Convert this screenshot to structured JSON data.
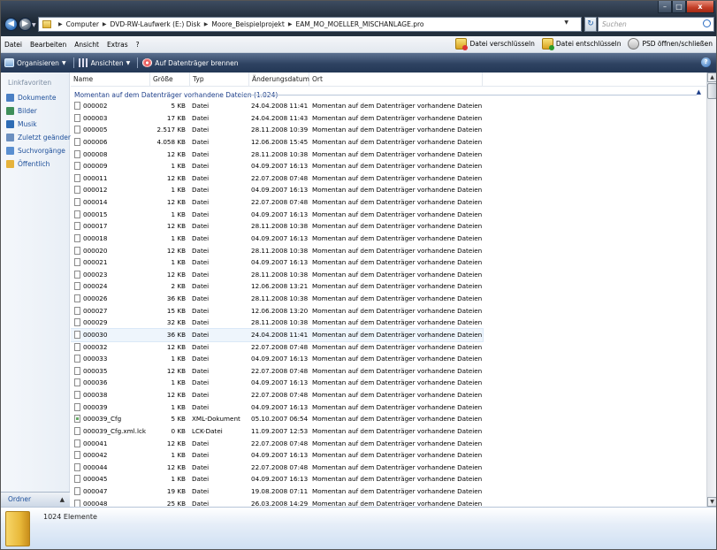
{
  "window": {
    "minimize_label": "–",
    "maximize_label": "□",
    "close_label": "x"
  },
  "address": {
    "crumbs": [
      "Computer",
      "DVD-RW-Laufwerk (E:) Disk",
      "Moore_Beispielprojekt",
      "EAM_MO_MOELLER_MISCHANLAGE.pro"
    ],
    "search_placeholder": "Suchen"
  },
  "menu": {
    "items": [
      "Datei",
      "Bearbeiten",
      "Ansicht",
      "Extras",
      "?"
    ],
    "right": [
      "Datei verschlüsseln",
      "Datei entschlüsseln",
      "PSD öffnen/schließen"
    ]
  },
  "toolbar": {
    "organize": "Organisieren",
    "views": "Ansichten",
    "burn": "Auf Datenträger brennen"
  },
  "navpane": {
    "heading": "Linkfavoriten",
    "links": [
      "Dokumente",
      "Bilder",
      "Musik",
      "Zuletzt geändert",
      "Suchvorgänge",
      "Öffentlich"
    ],
    "icon_colors": [
      "#4a7fc4",
      "#3f8f5a",
      "#2e6cb5",
      "#6b8fc0",
      "#5a8fd0",
      "#e6b33c"
    ],
    "folders_label": "Ordner"
  },
  "columns": {
    "name": "Name",
    "size": "Größe",
    "type": "Typ",
    "date": "Änderungsdatum",
    "location": "Ort"
  },
  "group_header": "Momentan auf dem Datenträger vorhandene Dateien (1.024)",
  "files": [
    {
      "name": "000002",
      "size": "5 KB",
      "type": "Datei",
      "date": "24.04.2008 11:41",
      "ort": "Momentan auf dem Datenträger vorhandene Dateien"
    },
    {
      "name": "000003",
      "size": "17 KB",
      "type": "Datei",
      "date": "24.04.2008 11:43",
      "ort": "Momentan auf dem Datenträger vorhandene Dateien"
    },
    {
      "name": "000005",
      "size": "2.517 KB",
      "type": "Datei",
      "date": "28.11.2008 10:39",
      "ort": "Momentan auf dem Datenträger vorhandene Dateien"
    },
    {
      "name": "000006",
      "size": "4.058 KB",
      "type": "Datei",
      "date": "12.06.2008 15:45",
      "ort": "Momentan auf dem Datenträger vorhandene Dateien"
    },
    {
      "name": "000008",
      "size": "12 KB",
      "type": "Datei",
      "date": "28.11.2008 10:38",
      "ort": "Momentan auf dem Datenträger vorhandene Dateien"
    },
    {
      "name": "000009",
      "size": "1 KB",
      "type": "Datei",
      "date": "04.09.2007 16:13",
      "ort": "Momentan auf dem Datenträger vorhandene Dateien"
    },
    {
      "name": "000011",
      "size": "12 KB",
      "type": "Datei",
      "date": "22.07.2008 07:48",
      "ort": "Momentan auf dem Datenträger vorhandene Dateien"
    },
    {
      "name": "000012",
      "size": "1 KB",
      "type": "Datei",
      "date": "04.09.2007 16:13",
      "ort": "Momentan auf dem Datenträger vorhandene Dateien"
    },
    {
      "name": "000014",
      "size": "12 KB",
      "type": "Datei",
      "date": "22.07.2008 07:48",
      "ort": "Momentan auf dem Datenträger vorhandene Dateien"
    },
    {
      "name": "000015",
      "size": "1 KB",
      "type": "Datei",
      "date": "04.09.2007 16:13",
      "ort": "Momentan auf dem Datenträger vorhandene Dateien"
    },
    {
      "name": "000017",
      "size": "12 KB",
      "type": "Datei",
      "date": "28.11.2008 10:38",
      "ort": "Momentan auf dem Datenträger vorhandene Dateien"
    },
    {
      "name": "000018",
      "size": "1 KB",
      "type": "Datei",
      "date": "04.09.2007 16:13",
      "ort": "Momentan auf dem Datenträger vorhandene Dateien"
    },
    {
      "name": "000020",
      "size": "12 KB",
      "type": "Datei",
      "date": "28.11.2008 10:38",
      "ort": "Momentan auf dem Datenträger vorhandene Dateien"
    },
    {
      "name": "000021",
      "size": "1 KB",
      "type": "Datei",
      "date": "04.09.2007 16:13",
      "ort": "Momentan auf dem Datenträger vorhandene Dateien"
    },
    {
      "name": "000023",
      "size": "12 KB",
      "type": "Datei",
      "date": "28.11.2008 10:38",
      "ort": "Momentan auf dem Datenträger vorhandene Dateien"
    },
    {
      "name": "000024",
      "size": "2 KB",
      "type": "Datei",
      "date": "12.06.2008 13:21",
      "ort": "Momentan auf dem Datenträger vorhandene Dateien"
    },
    {
      "name": "000026",
      "size": "36 KB",
      "type": "Datei",
      "date": "28.11.2008 10:38",
      "ort": "Momentan auf dem Datenträger vorhandene Dateien"
    },
    {
      "name": "000027",
      "size": "15 KB",
      "type": "Datei",
      "date": "12.06.2008 13:20",
      "ort": "Momentan auf dem Datenträger vorhandene Dateien"
    },
    {
      "name": "000029",
      "size": "32 KB",
      "type": "Datei",
      "date": "28.11.2008 10:38",
      "ort": "Momentan auf dem Datenträger vorhandene Dateien"
    },
    {
      "name": "000030",
      "size": "36 KB",
      "type": "Datei",
      "date": "24.04.2008 11:41",
      "ort": "Momentan auf dem Datenträger vorhandene Dateien",
      "selected": true
    },
    {
      "name": "000032",
      "size": "12 KB",
      "type": "Datei",
      "date": "22.07.2008 07:48",
      "ort": "Momentan auf dem Datenträger vorhandene Dateien"
    },
    {
      "name": "000033",
      "size": "1 KB",
      "type": "Datei",
      "date": "04.09.2007 16:13",
      "ort": "Momentan auf dem Datenträger vorhandene Dateien"
    },
    {
      "name": "000035",
      "size": "12 KB",
      "type": "Datei",
      "date": "22.07.2008 07:48",
      "ort": "Momentan auf dem Datenträger vorhandene Dateien"
    },
    {
      "name": "000036",
      "size": "1 KB",
      "type": "Datei",
      "date": "04.09.2007 16:13",
      "ort": "Momentan auf dem Datenträger vorhandene Dateien"
    },
    {
      "name": "000038",
      "size": "12 KB",
      "type": "Datei",
      "date": "22.07.2008 07:48",
      "ort": "Momentan auf dem Datenträger vorhandene Dateien"
    },
    {
      "name": "000039",
      "size": "1 KB",
      "type": "Datei",
      "date": "04.09.2007 16:13",
      "ort": "Momentan auf dem Datenträger vorhandene Dateien"
    },
    {
      "name": "000039_Cfg",
      "size": "5 KB",
      "type": "XML-Dokument",
      "date": "05.10.2007 06:54",
      "ort": "Momentan auf dem Datenträger vorhandene Dateien",
      "icon": "xml"
    },
    {
      "name": "000039_Cfg.xml.lck",
      "size": "0 KB",
      "type": "LCK-Datei",
      "date": "11.09.2007 12:53",
      "ort": "Momentan auf dem Datenträger vorhandene Dateien"
    },
    {
      "name": "000041",
      "size": "12 KB",
      "type": "Datei",
      "date": "22.07.2008 07:48",
      "ort": "Momentan auf dem Datenträger vorhandene Dateien"
    },
    {
      "name": "000042",
      "size": "1 KB",
      "type": "Datei",
      "date": "04.09.2007 16:13",
      "ort": "Momentan auf dem Datenträger vorhandene Dateien"
    },
    {
      "name": "000044",
      "size": "12 KB",
      "type": "Datei",
      "date": "22.07.2008 07:48",
      "ort": "Momentan auf dem Datenträger vorhandene Dateien"
    },
    {
      "name": "000045",
      "size": "1 KB",
      "type": "Datei",
      "date": "04.09.2007 16:13",
      "ort": "Momentan auf dem Datenträger vorhandene Dateien"
    },
    {
      "name": "000047",
      "size": "19 KB",
      "type": "Datei",
      "date": "19.08.2008 07:11",
      "ort": "Momentan auf dem Datenträger vorhandene Dateien"
    },
    {
      "name": "000048",
      "size": "25 KB",
      "type": "Datei",
      "date": "26.03.2008 14:29",
      "ort": "Momentan auf dem Datenträger vorhandene Dateien"
    }
  ],
  "details": {
    "count": "1024 Elemente"
  }
}
